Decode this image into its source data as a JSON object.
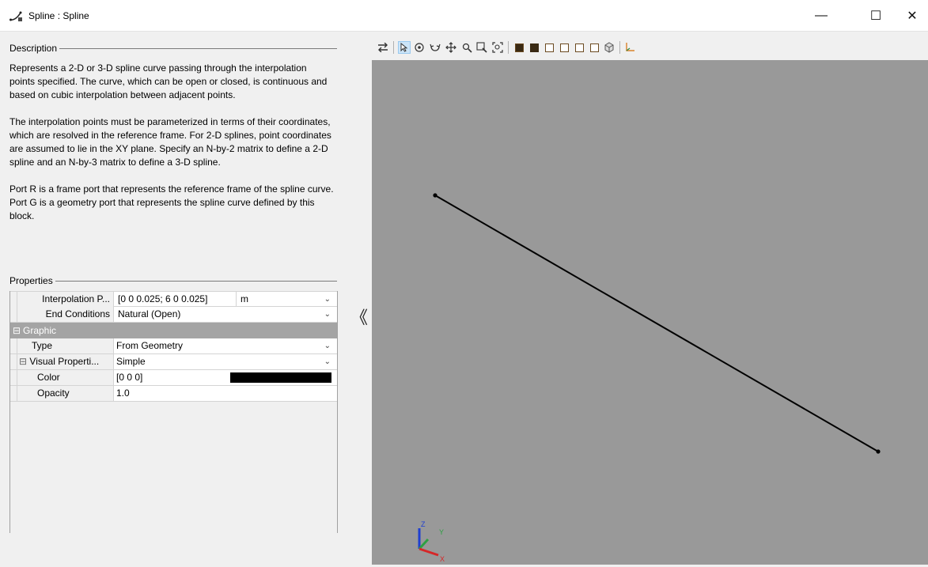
{
  "window": {
    "title": "Spline : Spline",
    "minimize_glyph": "—",
    "maximize_glyph": "☐",
    "close_glyph": "✕"
  },
  "description": {
    "header": "Description",
    "paragraphs": [
      "Represents a 2-D or 3-D spline curve passing through the interpolation points specified. The curve, which can be open or closed, is continuous and based on cubic interpolation between adjacent points.",
      "The interpolation points must be parameterized in terms of their coordinates, which are resolved in the reference frame. For 2-D splines, point coordinates are assumed to lie in the XY plane. Specify an N-by-2 matrix to define a 2-D spline and an N-by-3 matrix to define a 3-D spline.",
      "Port R is a frame port that represents the reference frame of the spline curve. Port G is a geometry port that represents the spline curve defined by this block."
    ]
  },
  "properties": {
    "header": "Properties",
    "interpolation_points": {
      "label": "Interpolation P...",
      "value": "[0 0 0.025; 6 0 0.025]",
      "unit": "m"
    },
    "end_conditions": {
      "label": "End Conditions",
      "value": "Natural (Open)"
    },
    "graphic_group": {
      "label": "Graphic",
      "toggle": "⊟"
    },
    "type": {
      "label": "Type",
      "value": "From Geometry"
    },
    "visual_properties": {
      "label": "Visual Properti...",
      "value": "Simple",
      "toggle": "⊟"
    },
    "color": {
      "label": "Color",
      "value": "[0 0 0]",
      "swatch": "#000000"
    },
    "opacity": {
      "label": "Opacity",
      "value": "1.0"
    }
  },
  "collapse_glyph": "《",
  "toolbar": {
    "icons": [
      "swap-icon",
      "select-icon",
      "rotate-icon",
      "roll-icon",
      "pan-icon",
      "zoom-icon",
      "zoom-box-icon",
      "fit-icon",
      "view-front-icon",
      "view-back-icon",
      "view-left-icon",
      "view-right-icon",
      "view-top-icon",
      "view-bottom-icon",
      "view-iso-icon",
      "axes-toggle-icon"
    ]
  },
  "viewport": {
    "background": "#999999",
    "curve_color": "#000000",
    "triad_labels": {
      "z": "Z",
      "y": "Y",
      "x": "X"
    }
  }
}
